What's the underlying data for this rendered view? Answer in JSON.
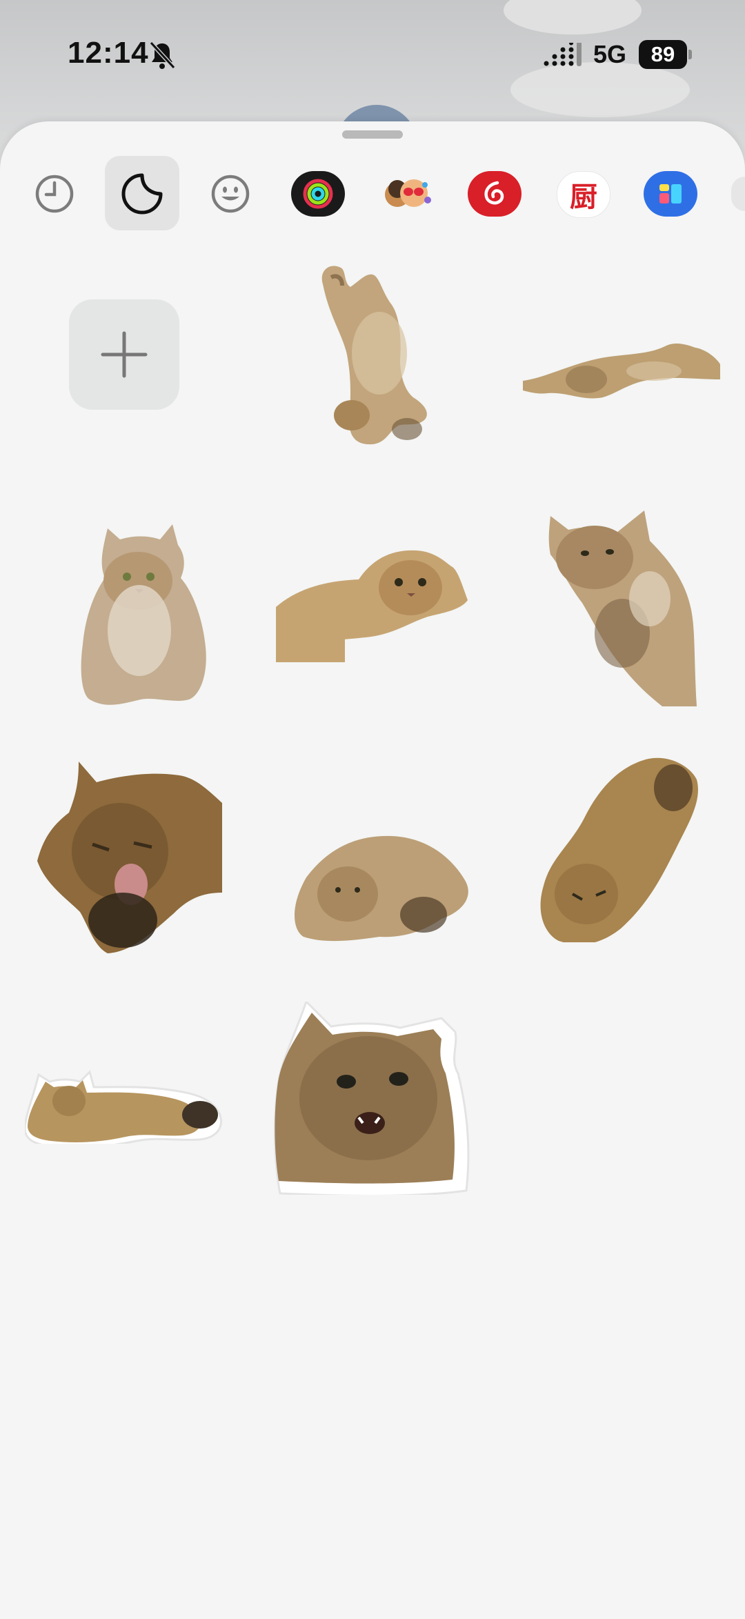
{
  "status_bar": {
    "time": "12:14",
    "network": "5G",
    "battery": "89",
    "icons": [
      "bell-slash-icon",
      "signal-icon"
    ]
  },
  "toolbar": {
    "items": [
      {
        "name": "recents",
        "icon": "clock-icon"
      },
      {
        "name": "stickers",
        "icon": "sticker-icon",
        "selected": true
      },
      {
        "name": "emoji",
        "icon": "smiley-icon"
      },
      {
        "name": "activity",
        "icon": "activity-rings-icon"
      },
      {
        "name": "memoji",
        "icon": "memoji-icon"
      },
      {
        "name": "netease-music",
        "icon": "netease-music-icon"
      },
      {
        "name": "kitchen-app",
        "icon": "kitchen-app-icon",
        "glyph": "厨"
      },
      {
        "name": "blue-app",
        "icon": "blue-app-icon"
      }
    ]
  },
  "stickers": {
    "add_icon": "plus-icon",
    "items": [
      {
        "name": "cat-lying-belly-up"
      },
      {
        "name": "cat-stretching-flat"
      },
      {
        "name": "cat-sitting"
      },
      {
        "name": "cat-lying-looking"
      },
      {
        "name": "cat-climbing"
      },
      {
        "name": "cat-yawning"
      },
      {
        "name": "cat-loaf"
      },
      {
        "name": "cat-curled-sleeping"
      },
      {
        "name": "cat-lying-side-outlined"
      },
      {
        "name": "cat-hissing-outlined"
      }
    ]
  },
  "colors": {
    "sheet": "#f4f5f4",
    "selected_tab": "#e3e3e3",
    "cat_fur": "#b99a6c"
  }
}
